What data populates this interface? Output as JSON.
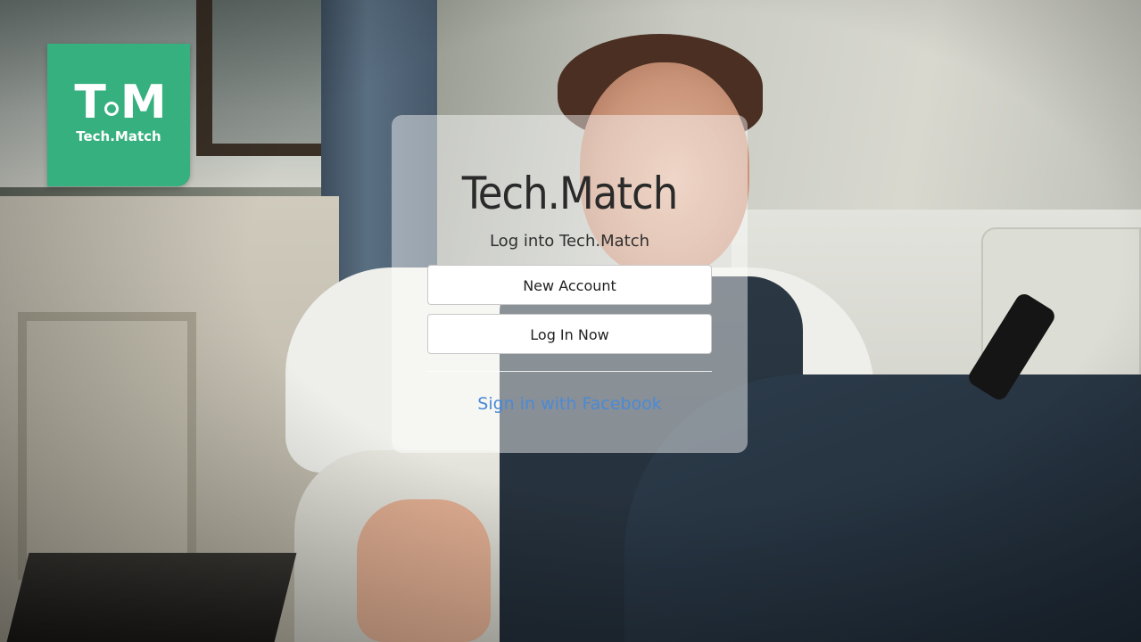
{
  "logo": {
    "mark_left": "T",
    "mark_right": "M",
    "text": "Tech.Match"
  },
  "card": {
    "title": "Tech.Match",
    "subtitle": "Log into Tech.Match",
    "new_account_label": "New Account",
    "login_label": "Log In Now",
    "facebook_label": "Sign in with Facebook"
  },
  "colors": {
    "brand_green": "#36b07e",
    "link_blue": "#4a8ad6"
  }
}
